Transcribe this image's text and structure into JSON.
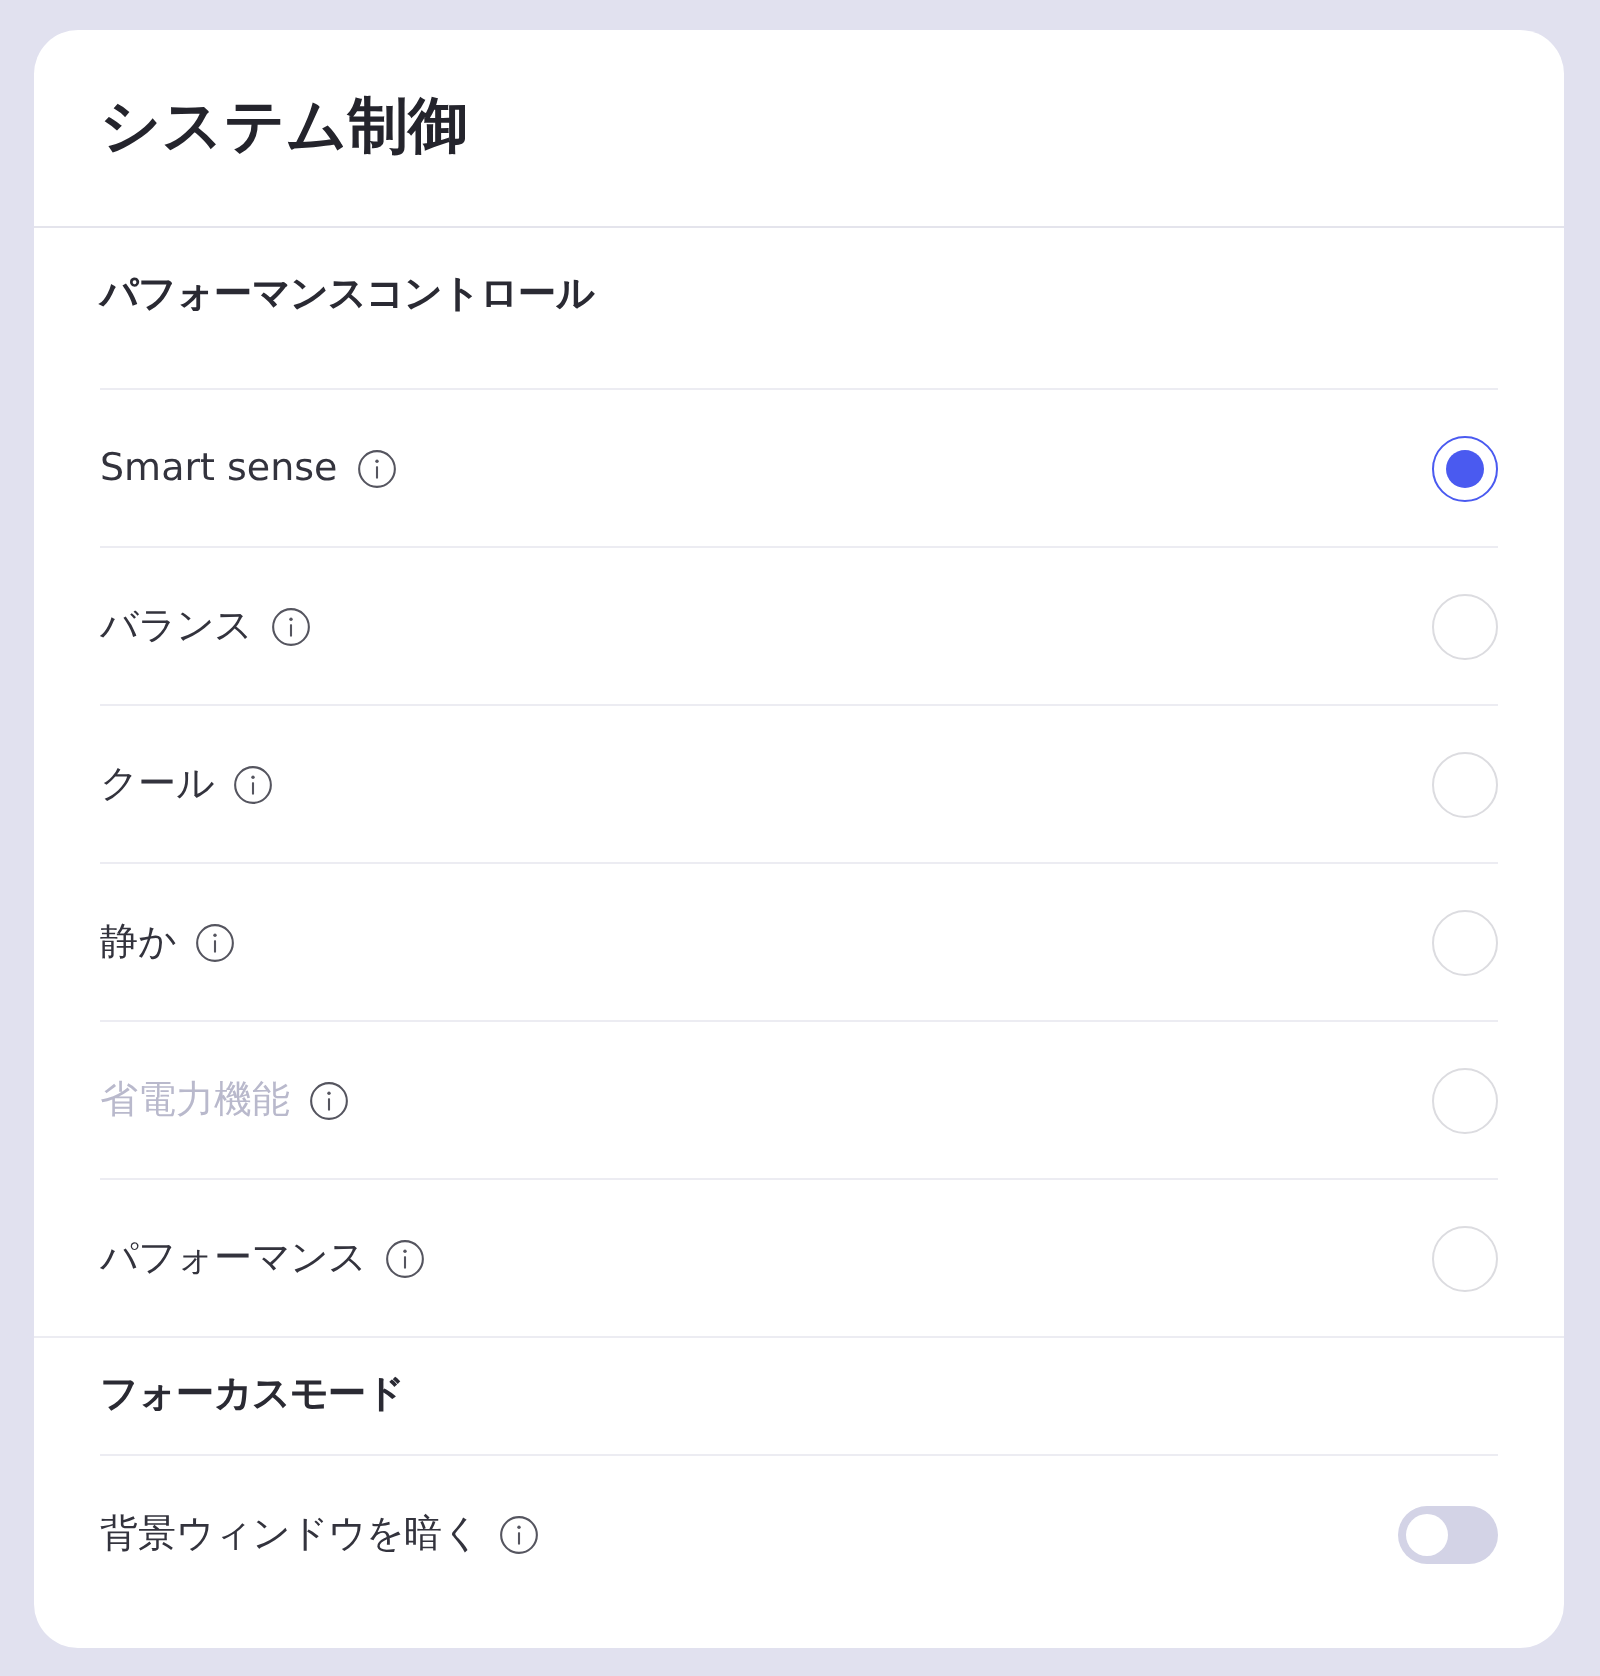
{
  "window": {
    "title": "システム制御"
  },
  "sections": [
    {
      "heading": "パフォーマンスコントロール",
      "items": [
        {
          "kind": "radio",
          "label": "Smart sense",
          "selected": true,
          "disabled": false
        },
        {
          "kind": "radio",
          "label": "バランス",
          "selected": false,
          "disabled": false
        },
        {
          "kind": "radio",
          "label": "クール",
          "selected": false,
          "disabled": false
        },
        {
          "kind": "radio",
          "label": "静か",
          "selected": false,
          "disabled": false
        },
        {
          "kind": "radio",
          "label": "省電力機能",
          "selected": false,
          "disabled": true
        },
        {
          "kind": "radio",
          "label": "パフォーマンス",
          "selected": false,
          "disabled": false
        }
      ]
    },
    {
      "heading": "フォーカスモード",
      "items": [
        {
          "kind": "toggle",
          "label": "背景ウィンドウを暗く",
          "on": false
        }
      ]
    }
  ]
}
